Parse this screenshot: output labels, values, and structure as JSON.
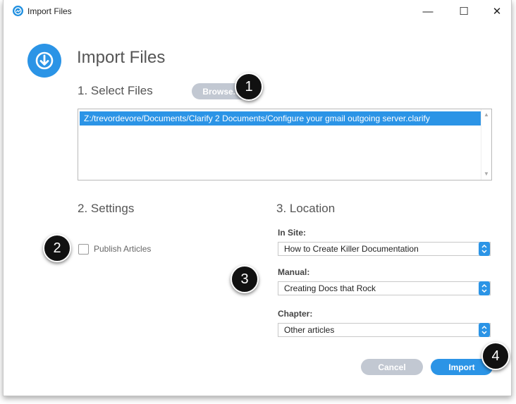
{
  "window": {
    "title": "Import Files",
    "controls": {
      "minimize": "—",
      "maximize": "☐",
      "close": "✕"
    }
  },
  "header": {
    "title": "Import Files",
    "icon": "download-circle-icon"
  },
  "select_files": {
    "title": "1. Select Files",
    "browse_label": "Browse...",
    "files": [
      "Z:/trevordevore/Documents/Clarify 2 Documents/Configure your gmail outgoing server.clarify"
    ]
  },
  "settings": {
    "title": "2. Settings",
    "publish_label": "Publish Articles",
    "publish_checked": false
  },
  "location": {
    "title": "3. Location",
    "site_label": "In Site:",
    "site_value": "How to Create Killer Documentation",
    "manual_label": "Manual:",
    "manual_value": "Creating Docs that Rock",
    "chapter_label": "Chapter:",
    "chapter_value": "Other articles"
  },
  "actions": {
    "cancel_label": "Cancel",
    "import_label": "Import"
  },
  "callouts": [
    "1",
    "2",
    "3",
    "4"
  ],
  "colors": {
    "accent": "#2b94e6",
    "disabled": "#c2c8d2",
    "callout": "#111111"
  }
}
